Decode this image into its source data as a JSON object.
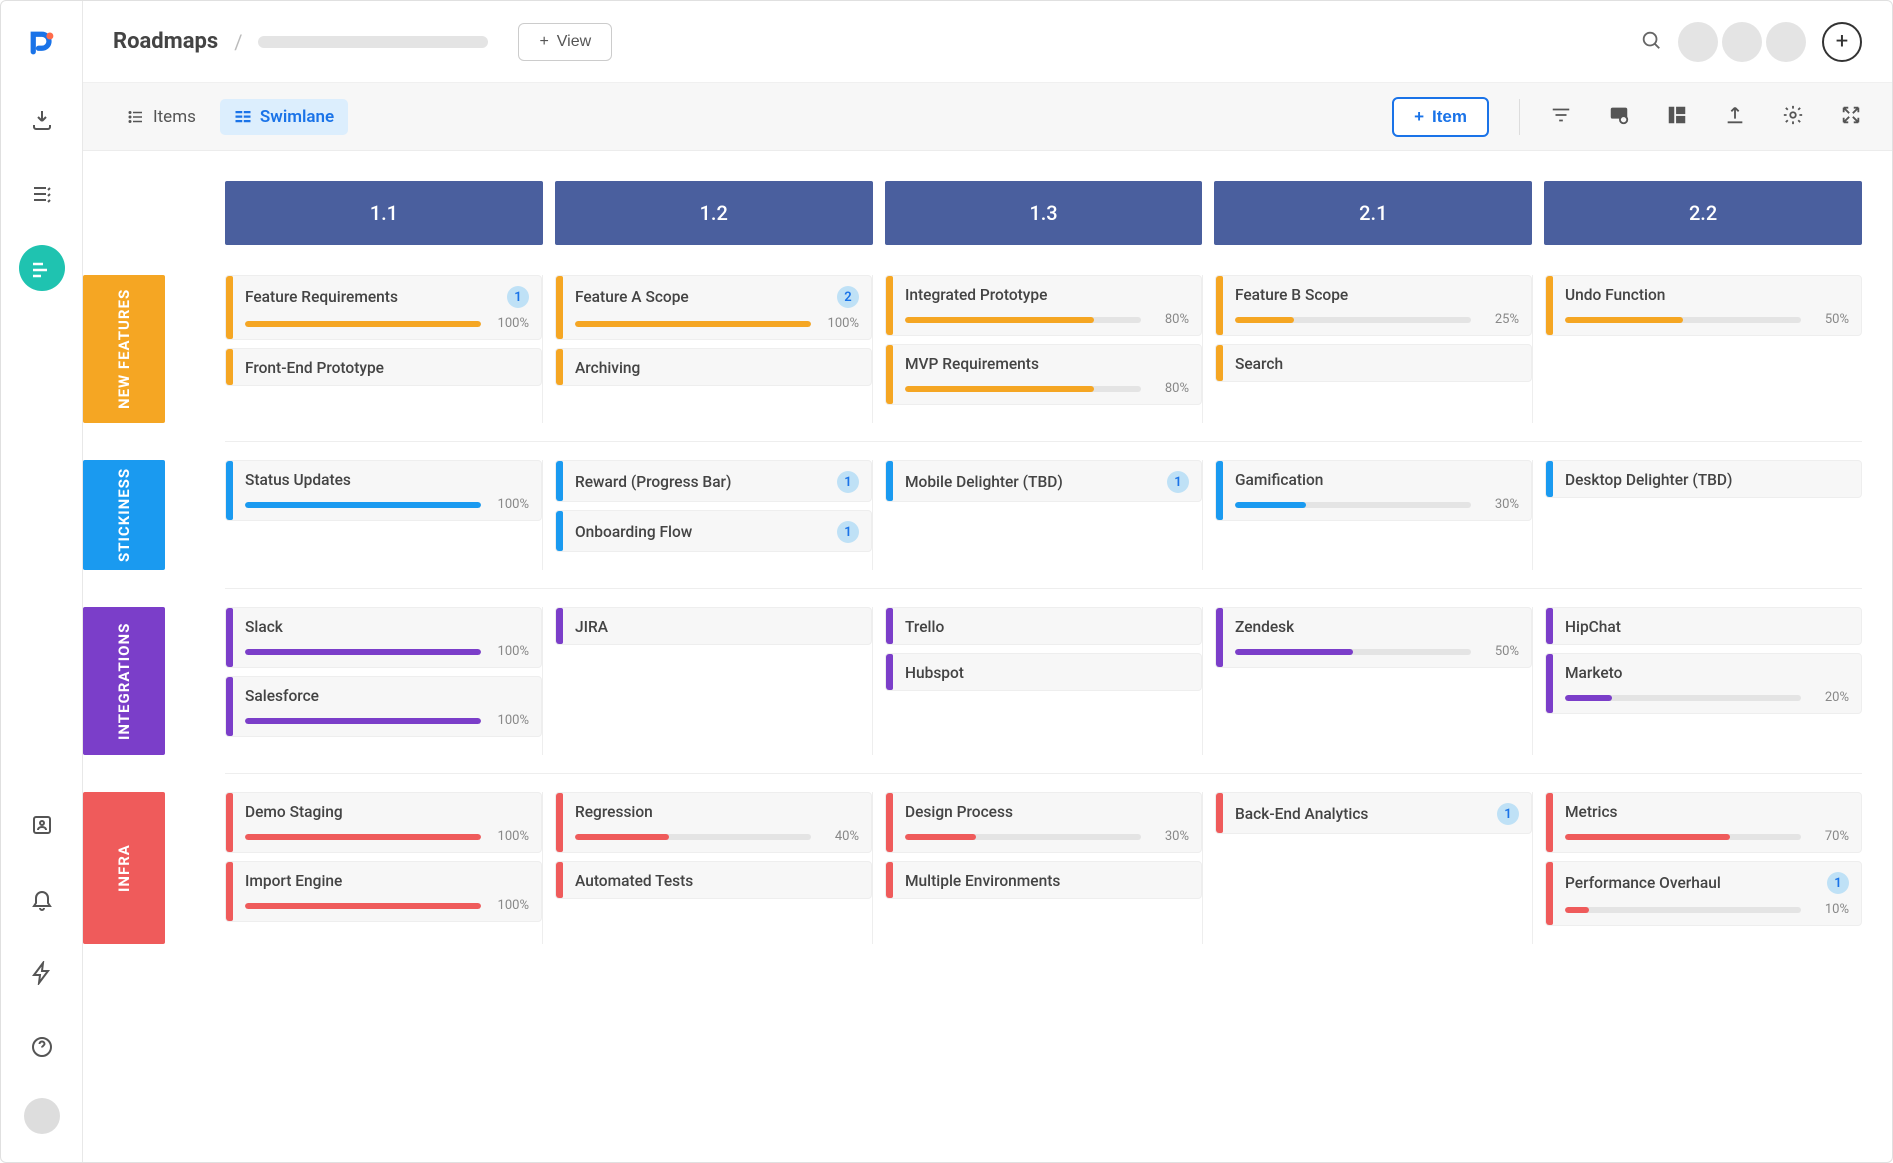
{
  "header": {
    "title": "Roadmaps",
    "view_btn": "View"
  },
  "toolbar": {
    "tab_items": "Items",
    "tab_swimlane": "Swimlane",
    "item_btn": "Item"
  },
  "columns": [
    "1.1",
    "1.2",
    "1.3",
    "2.1",
    "2.2"
  ],
  "lanes": [
    {
      "name": "NEW FEATURES",
      "color": "c-orange",
      "hex": "#f5a623",
      "cells": [
        [
          {
            "title": "Feature Requirements",
            "progress": 100,
            "badge": 1
          },
          {
            "title": "Front-End Prototype"
          }
        ],
        [
          {
            "title": "Feature A Scope",
            "progress": 100,
            "badge": 2
          },
          {
            "title": "Archiving"
          }
        ],
        [
          {
            "title": "Integrated Prototype",
            "progress": 80
          },
          {
            "title": "MVP Requirements",
            "progress": 80
          }
        ],
        [
          {
            "title": "Feature B Scope",
            "progress": 25
          },
          {
            "title": "Search"
          }
        ],
        [
          {
            "title": "Undo Function",
            "progress": 50
          }
        ]
      ]
    },
    {
      "name": "STICKINESS",
      "color": "c-blue",
      "hex": "#1a9af0",
      "cells": [
        [
          {
            "title": "Status Updates",
            "progress": 100
          }
        ],
        [
          {
            "title": "Reward (Progress Bar)",
            "badge": 1
          },
          {
            "title": "Onboarding Flow",
            "badge": 1
          }
        ],
        [
          {
            "title": "Mobile Delighter (TBD)",
            "badge": 1
          }
        ],
        [
          {
            "title": "Gamification",
            "progress": 30
          }
        ],
        [
          {
            "title": "Desktop Delighter (TBD)"
          }
        ]
      ]
    },
    {
      "name": "INTEGRATIONS",
      "color": "c-purple",
      "hex": "#7b3ec9",
      "cells": [
        [
          {
            "title": "Slack",
            "progress": 100
          },
          {
            "title": "Salesforce",
            "progress": 100
          }
        ],
        [
          {
            "title": "JIRA"
          }
        ],
        [
          {
            "title": "Trello"
          },
          {
            "title": "Hubspot"
          }
        ],
        [
          {
            "title": "Zendesk",
            "progress": 50
          }
        ],
        [
          {
            "title": "HipChat"
          },
          {
            "title": "Marketo",
            "progress": 20
          }
        ]
      ]
    },
    {
      "name": "INFRA",
      "color": "c-red",
      "hex": "#ef5b5b",
      "cells": [
        [
          {
            "title": "Demo Staging",
            "progress": 100
          },
          {
            "title": "Import Engine",
            "progress": 100
          }
        ],
        [
          {
            "title": "Regression",
            "progress": 40
          },
          {
            "title": "Automated Tests"
          }
        ],
        [
          {
            "title": "Design Process",
            "progress": 30
          },
          {
            "title": "Multiple Environments"
          }
        ],
        [
          {
            "title": "Back-End Analytics",
            "badge": 1
          }
        ],
        [
          {
            "title": "Metrics",
            "progress": 70
          },
          {
            "title": "Performance Overhaul",
            "progress": 10,
            "badge": 1
          }
        ]
      ]
    }
  ]
}
